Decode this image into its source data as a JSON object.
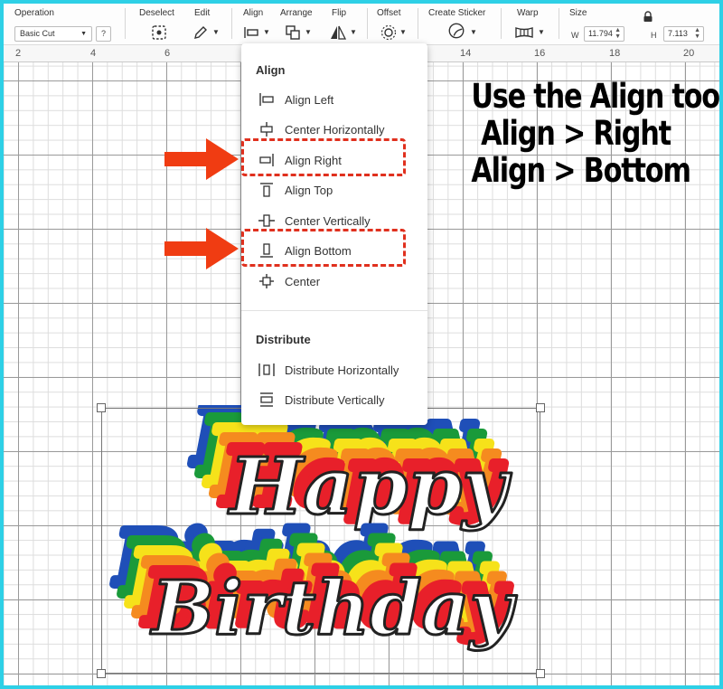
{
  "toolbar": {
    "operation": {
      "label": "Operation",
      "value": "Basic Cut",
      "help": "?"
    },
    "deselect": {
      "label": "Deselect"
    },
    "edit": {
      "label": "Edit"
    },
    "align": {
      "label": "Align"
    },
    "arrange": {
      "label": "Arrange"
    },
    "flip": {
      "label": "Flip"
    },
    "offset": {
      "label": "Offset"
    },
    "create_sticker": {
      "label": "Create Sticker"
    },
    "warp": {
      "label": "Warp"
    },
    "size": {
      "label": "Size",
      "w_label": "W",
      "w_value": "11.794",
      "h_label": "H",
      "h_value": "7.113",
      "lock_icon": "lock-icon"
    }
  },
  "ruler": {
    "labels": [
      "2",
      "4",
      "6",
      "14",
      "16",
      "18",
      "20"
    ]
  },
  "align_menu": {
    "heading": "Align",
    "items": [
      {
        "label": "Align Left",
        "icon": "align-left-icon"
      },
      {
        "label": "Center Horizontally",
        "icon": "center-horizontally-icon"
      },
      {
        "label": "Align Right",
        "icon": "align-right-icon"
      },
      {
        "label": "Align Top",
        "icon": "align-top-icon"
      },
      {
        "label": "Center Vertically",
        "icon": "center-vertically-icon"
      },
      {
        "label": "Align Bottom",
        "icon": "align-bottom-icon"
      },
      {
        "label": "Center",
        "icon": "center-icon"
      }
    ],
    "distribute_heading": "Distribute",
    "distribute_items": [
      {
        "label": "Distribute Horizontally",
        "icon": "distribute-horizontally-icon"
      },
      {
        "label": "Distribute Vertically",
        "icon": "distribute-vertically-icon"
      }
    ]
  },
  "instruction": {
    "line1": "Use the Align tool:",
    "line2": "Align > Right",
    "line3": "Align > Bottom"
  },
  "design": {
    "word1": "Happy",
    "word2": "Birthday"
  },
  "colors": {
    "border": "#2ed0e6",
    "highlight": "#e0301e",
    "arrow": "#f03c12",
    "rainbow": [
      "#1f4fb8",
      "#1a9a3a",
      "#f6e21a",
      "#f58b1f",
      "#e8202a"
    ]
  }
}
